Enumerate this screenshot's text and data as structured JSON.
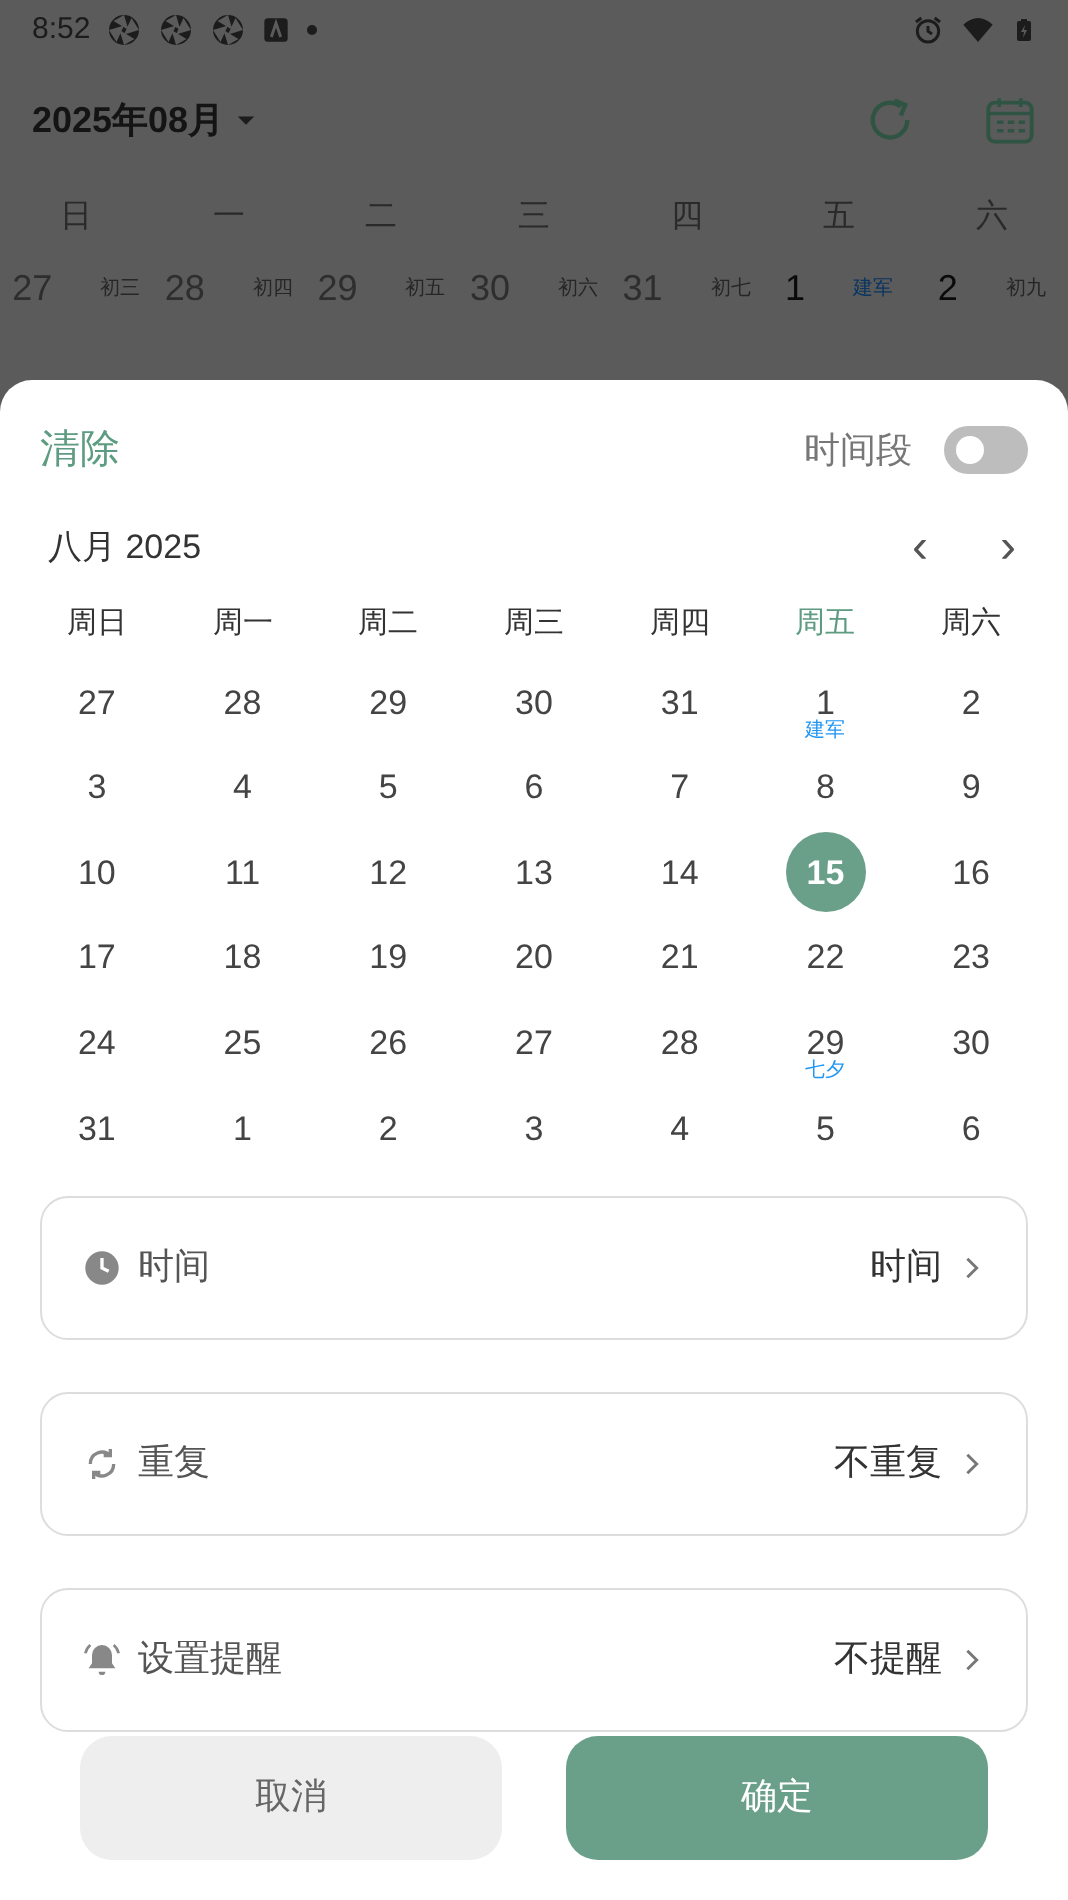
{
  "status_bar": {
    "time": "8:52"
  },
  "header": {
    "title": "2025年08月"
  },
  "background_calendar": {
    "weekdays": [
      "日",
      "一",
      "二",
      "三",
      "四",
      "五",
      "六"
    ],
    "days": [
      {
        "day": "27",
        "lunar": "初三",
        "in_month": false,
        "festival": false
      },
      {
        "day": "28",
        "lunar": "初四",
        "in_month": false,
        "festival": false
      },
      {
        "day": "29",
        "lunar": "初五",
        "in_month": false,
        "festival": false
      },
      {
        "day": "30",
        "lunar": "初六",
        "in_month": false,
        "festival": false
      },
      {
        "day": "31",
        "lunar": "初七",
        "in_month": false,
        "festival": false
      },
      {
        "day": "1",
        "lunar": "建军",
        "in_month": true,
        "festival": true
      },
      {
        "day": "2",
        "lunar": "初九",
        "in_month": true,
        "festival": false
      }
    ]
  },
  "sheet": {
    "clear": "清除",
    "time_range": {
      "label": "时间段",
      "on": false
    },
    "month_title": "八月 2025",
    "prev": "‹",
    "next": "›",
    "weekdays": [
      {
        "label": "周日",
        "highlighted": false
      },
      {
        "label": "周一",
        "highlighted": false
      },
      {
        "label": "周二",
        "highlighted": false
      },
      {
        "label": "周三",
        "highlighted": false
      },
      {
        "label": "周四",
        "highlighted": false
      },
      {
        "label": "周五",
        "highlighted": true
      },
      {
        "label": "周六",
        "highlighted": false
      }
    ],
    "days": [
      {
        "day": "27",
        "selected": false
      },
      {
        "day": "28",
        "selected": false
      },
      {
        "day": "29",
        "selected": false
      },
      {
        "day": "30",
        "selected": false
      },
      {
        "day": "31",
        "selected": false
      },
      {
        "day": "1",
        "lunar": "建军",
        "selected": false
      },
      {
        "day": "2",
        "selected": false
      },
      {
        "day": "3",
        "selected": false
      },
      {
        "day": "4",
        "selected": false
      },
      {
        "day": "5",
        "selected": false
      },
      {
        "day": "6",
        "selected": false
      },
      {
        "day": "7",
        "selected": false
      },
      {
        "day": "8",
        "selected": false
      },
      {
        "day": "9",
        "selected": false
      },
      {
        "day": "10",
        "selected": false
      },
      {
        "day": "11",
        "selected": false
      },
      {
        "day": "12",
        "selected": false
      },
      {
        "day": "13",
        "selected": false
      },
      {
        "day": "14",
        "selected": false
      },
      {
        "day": "15",
        "selected": true
      },
      {
        "day": "16",
        "selected": false
      },
      {
        "day": "17",
        "selected": false
      },
      {
        "day": "18",
        "selected": false
      },
      {
        "day": "19",
        "selected": false
      },
      {
        "day": "20",
        "selected": false
      },
      {
        "day": "21",
        "selected": false
      },
      {
        "day": "22",
        "selected": false
      },
      {
        "day": "23",
        "selected": false
      },
      {
        "day": "24",
        "selected": false
      },
      {
        "day": "25",
        "selected": false
      },
      {
        "day": "26",
        "selected": false
      },
      {
        "day": "27",
        "selected": false
      },
      {
        "day": "28",
        "selected": false
      },
      {
        "day": "29",
        "lunar": "七夕",
        "selected": false
      },
      {
        "day": "30",
        "selected": false
      },
      {
        "day": "31",
        "selected": false
      },
      {
        "day": "1",
        "selected": false
      },
      {
        "day": "2",
        "selected": false
      },
      {
        "day": "3",
        "selected": false
      },
      {
        "day": "4",
        "selected": false
      },
      {
        "day": "5",
        "selected": false
      },
      {
        "day": "6",
        "selected": false
      }
    ],
    "settings": [
      {
        "kind": "time",
        "label": "时间",
        "value": "时间"
      },
      {
        "kind": "repeat",
        "label": "重复",
        "value": "不重复"
      },
      {
        "kind": "reminder",
        "label": "设置提醒",
        "value": "不提醒"
      }
    ],
    "buttons": [
      {
        "kind": "secondary",
        "label": "取消"
      },
      {
        "kind": "primary",
        "label": "确定"
      }
    ]
  }
}
